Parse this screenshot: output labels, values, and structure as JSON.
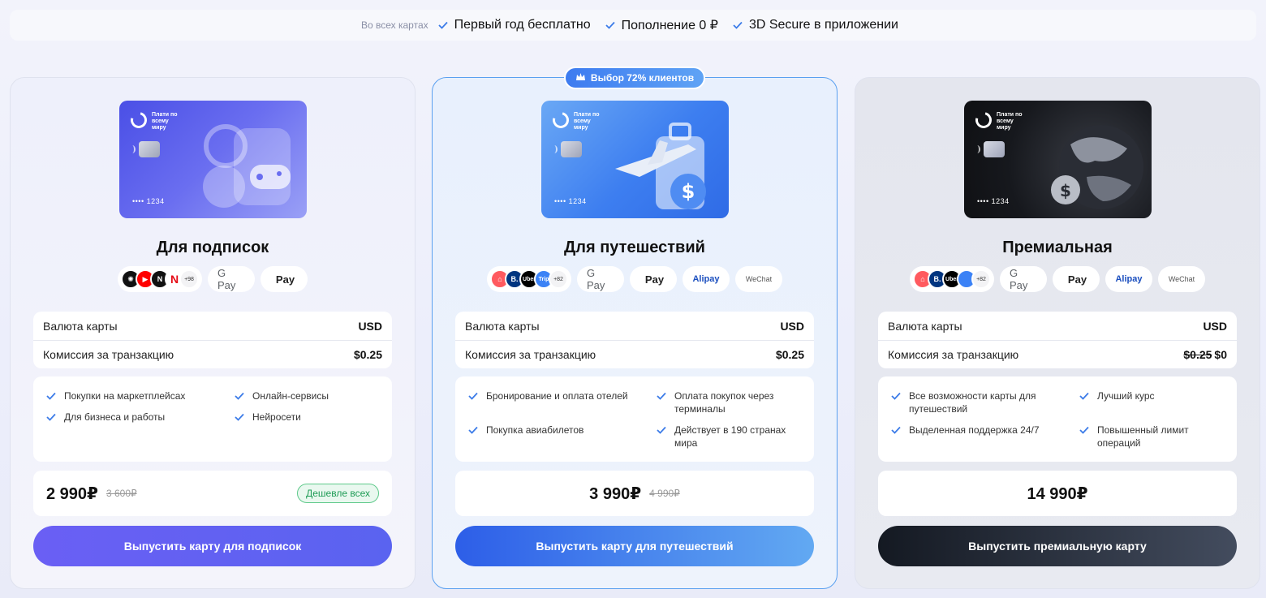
{
  "top_bar": {
    "muted_label": "Во всех картах",
    "features": [
      "Первый год бесплатно",
      "Пополнение 0 ₽",
      "3D Secure в приложении"
    ]
  },
  "cards": [
    {
      "title": "Для подписок",
      "card_logo": "Плати по всему миру",
      "card_number": "•••• 1234",
      "merchant_icons": [
        "chatgpt-icon",
        "youtube-icon",
        "notion-icon",
        "netflix-icon"
      ],
      "merchant_more": "+98",
      "payments": [
        "G Pay",
        "Pay"
      ],
      "rows": [
        {
          "label": "Валюта карты",
          "value": "USD"
        },
        {
          "label": "Комиссия за транзакцию",
          "value": "$0.25"
        }
      ],
      "features": [
        "Покупки на маркетплейсах",
        "Онлайн-сервисы",
        "Для бизнеса и работы",
        "Нейросети"
      ],
      "price": "2 990₽",
      "old_price": "3 600₽",
      "price_tag": "Дешевле всех",
      "cta": "Выпустить карту для подписок"
    },
    {
      "badge": "Выбор 72% клиентов",
      "title": "Для путешествий",
      "card_logo": "Плати по всему миру",
      "card_number": "•••• 1234",
      "merchant_icons": [
        "airbnb-icon",
        "booking-icon",
        "uber-icon",
        "trip-icon"
      ],
      "merchant_labels": [
        "",
        "B.",
        "Uber",
        "Trip"
      ],
      "merchant_more": "+82",
      "payments": [
        "G Pay",
        "Pay",
        "Alipay",
        "WeChat"
      ],
      "rows": [
        {
          "label": "Валюта карты",
          "value": "USD"
        },
        {
          "label": "Комиссия за транзакцию",
          "value": "$0.25"
        }
      ],
      "features": [
        "Бронирование и оплата отелей",
        "Оплата покупок через терминалы",
        "Покупка авиабилетов",
        "Действует в 190 странах мира"
      ],
      "price": "3 990₽",
      "old_price": "4 990₽",
      "cta": "Выпустить карту для путешествий"
    },
    {
      "title": "Премиальная",
      "card_logo": "Плати по всему миру",
      "card_number": "•••• 1234",
      "merchant_icons": [
        "airbnb-icon",
        "booking-icon",
        "uber-icon",
        "trip-icon"
      ],
      "merchant_labels": [
        "",
        "B.",
        "Uber",
        ""
      ],
      "merchant_more": "+82",
      "payments": [
        "G Pay",
        "Pay",
        "Alipay",
        "WeChat"
      ],
      "rows": [
        {
          "label": "Валюта карты",
          "value": "USD"
        },
        {
          "label": "Комиссия за транзакцию",
          "value_old": "$0.25",
          "value": "$0"
        }
      ],
      "features": [
        "Все возможности карты для путешествий",
        "Лучший курс",
        "Выделенная поддержка 24/7",
        "Повышенный лимит операций"
      ],
      "price": "14 990₽",
      "cta": "Выпустить премиальную карту"
    }
  ],
  "colors": {
    "check": "#3b7be8",
    "featured_border": "#5aa0f0",
    "tag_green": "#1f9c56"
  }
}
